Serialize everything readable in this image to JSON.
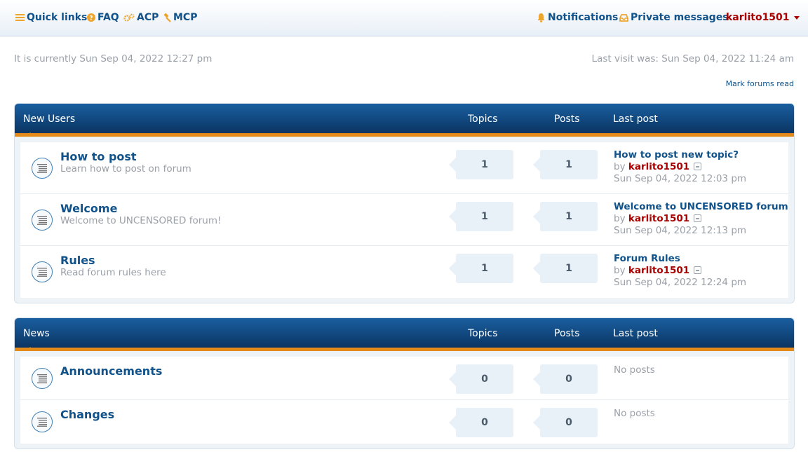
{
  "nav": {
    "quick_links": "Quick links",
    "faq": "FAQ",
    "acp": "ACP",
    "mcp": "MCP",
    "notifications": "Notifications",
    "private_messages": "Private messages",
    "username": "karlito1501"
  },
  "meta": {
    "current_time": "It is currently Sun Sep 04, 2022 12:27 pm",
    "last_visit": "Last visit was: Sun Sep 04, 2022 11:24 am",
    "mark_read": "Mark forums read"
  },
  "categories": [
    {
      "name": "New Users",
      "col_topics": "Topics",
      "col_posts": "Posts",
      "col_last": "Last post",
      "forums": [
        {
          "title": "How to post",
          "desc": "Learn how to post on forum",
          "topics": "1",
          "posts": "1",
          "last_title": "How to post new topic?",
          "by": "by",
          "author": "karlito1501",
          "date": "Sun Sep 04, 2022 12:03 pm"
        },
        {
          "title": "Welcome",
          "desc": "Welcome to UNCENSORED forum!",
          "topics": "1",
          "posts": "1",
          "last_title": "Welcome to UNCENSORED forum",
          "by": "by",
          "author": "karlito1501",
          "date": "Sun Sep 04, 2022 12:13 pm"
        },
        {
          "title": "Rules",
          "desc": "Read forum rules here",
          "topics": "1",
          "posts": "1",
          "last_title": "Forum Rules",
          "by": "by",
          "author": "karlito1501",
          "date": "Sun Sep 04, 2022 12:24 pm"
        }
      ]
    },
    {
      "name": "News",
      "col_topics": "Topics",
      "col_posts": "Posts",
      "col_last": "Last post",
      "forums": [
        {
          "title": "Announcements",
          "topics": "0",
          "posts": "0",
          "no_posts": "No posts"
        },
        {
          "title": "Changes",
          "topics": "0",
          "posts": "0",
          "no_posts": "No posts"
        }
      ]
    }
  ],
  "icons": {
    "quick_links": "hamburger-menu-icon",
    "faq": "question-circle-icon",
    "acp": "cogs-icon",
    "mcp": "gavel-icon",
    "notifications": "bell-icon",
    "private_messages": "inbox-icon",
    "user_menu": "caret-down-icon",
    "forum": "forum-read-icon",
    "view_latest": "view-latest-post-icon"
  },
  "colors": {
    "link": "#105289",
    "username": "#aa0000",
    "accent": "#e48a1a",
    "header_dark": "#0a3562",
    "icon_orange": "#eea52e"
  }
}
